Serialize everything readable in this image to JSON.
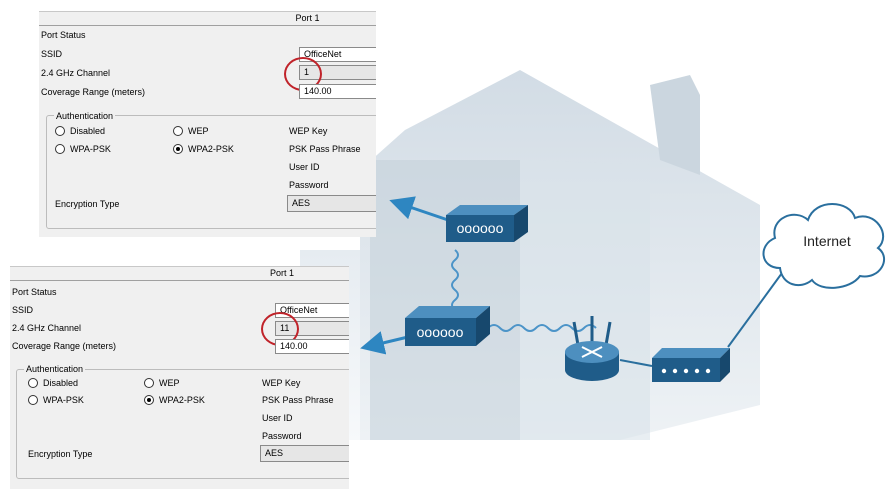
{
  "panel1": {
    "header": "Port 1",
    "port_status": "Port Status",
    "ssid_label": "SSID",
    "ssid_value": "OfficeNet",
    "channel_label": "2.4 GHz Channel",
    "channel_value": "1",
    "coverage_label": "Coverage Range (meters)",
    "coverage_value": "140.00",
    "auth_label": "Authentication",
    "disabled": "Disabled",
    "wep": "WEP",
    "wpa_psk": "WPA-PSK",
    "wpa2_psk": "WPA2-PSK",
    "selected_auth": "WPA2-PSK",
    "wep_key": "WEP Key",
    "psk_pass": "PSK Pass Phrase",
    "user_id": "User ID",
    "password": "Password",
    "encryption_label": "Encryption Type",
    "encryption_value": "AES"
  },
  "panel2": {
    "header": "Port 1",
    "port_status": "Port Status",
    "ssid_label": "SSID",
    "ssid_value": "OfficeNet",
    "channel_label": "2.4 GHz Channel",
    "channel_value": "11",
    "coverage_label": "Coverage Range (meters)",
    "coverage_value": "140.00",
    "auth_label": "Authentication",
    "disabled": "Disabled",
    "wep": "WEP",
    "wpa_psk": "WPA-PSK",
    "wpa2_psk": "WPA2-PSK",
    "selected_auth": "WPA2-PSK",
    "wep_key": "WEP Key",
    "psk_pass": "PSK Pass Phrase",
    "user_id": "User ID",
    "password": "Password",
    "encryption_label": "Encryption Type",
    "encryption_value": "AES"
  },
  "diagram": {
    "cloud_label": "Internet"
  },
  "colors": {
    "device": "#1f5c89",
    "device_top": "#4d8fbf",
    "arrow": "#2e86c1",
    "highlight": "#c0232a",
    "house": "#dde5ec"
  }
}
